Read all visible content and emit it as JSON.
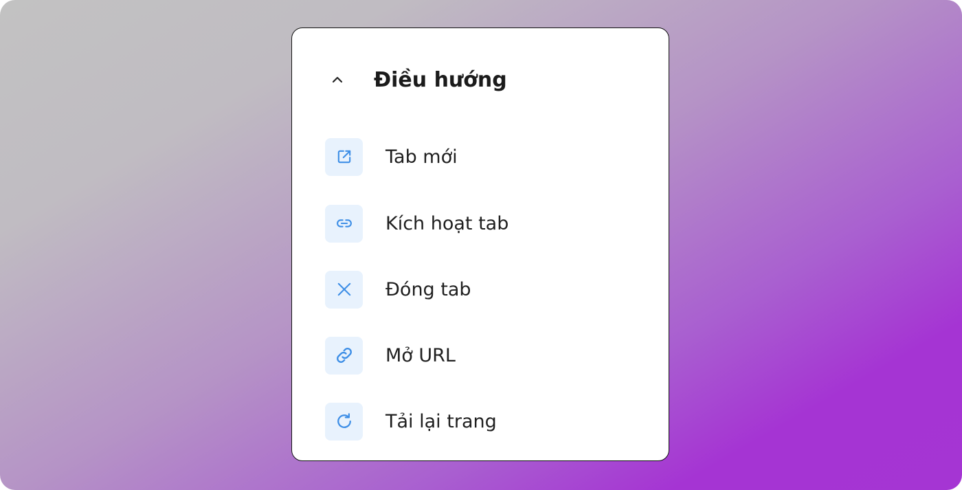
{
  "section": {
    "title": "Điều hướng",
    "chevron_icon": "chevron-up-icon"
  },
  "colors": {
    "icon_accent": "#3d8ee6",
    "icon_bg": "#e8f2fd"
  },
  "items": [
    {
      "label": "Tab mới",
      "icon": "external-link-icon"
    },
    {
      "label": "Kích hoạt tab",
      "icon": "link-icon"
    },
    {
      "label": "Đóng tab",
      "icon": "close-icon"
    },
    {
      "label": "Mở URL",
      "icon": "chain-link-icon"
    },
    {
      "label": "Tải lại trang",
      "icon": "refresh-icon"
    }
  ]
}
